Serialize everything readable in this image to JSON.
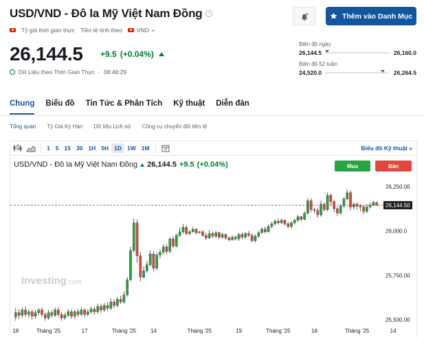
{
  "header": {
    "title": "USD/VND - Đô la Mỹ Việt Nam Đồng",
    "watchlist_label": "Thêm vào Danh Mục",
    "meta_realtime": "Tỷ giá thời gian thực",
    "meta_currency_label": "Tiền tệ tính theo",
    "meta_currency": "VND"
  },
  "quote": {
    "price": "26,144.5",
    "change": "+9.5",
    "change_pct": "(+0.04%)",
    "realtime_note": "Dữ Liệu theo Thời Gian Thực",
    "separator": "·",
    "time": "08:48:29"
  },
  "ranges": {
    "day_label": "Biên độ ngày",
    "day_low": "26,144.5",
    "day_high": "26,160.0",
    "week52_label": "Biên độ 52 tuần",
    "week52_low": "24,520.0",
    "week52_high": "26,264.5"
  },
  "tabs": [
    "Chung",
    "Biểu đồ",
    "Tin Tức & Phân Tích",
    "Kỹ thuật",
    "Diễn đàn"
  ],
  "subnav": [
    "Tổng quan",
    "Tỷ Giá Kỳ Hạn",
    "Dữ liệu Lịch sử",
    "Công cụ chuyển đổi tiền tệ"
  ],
  "toolbar": {
    "intervals": [
      "1",
      "5",
      "15",
      "30",
      "1H",
      "5H",
      "1D",
      "1W",
      "1M"
    ],
    "active_interval": "1D",
    "tech_chart_link": "Biểu đồ Kỹ thuật",
    "tech_chart_arrow": "»"
  },
  "chart_legend": {
    "name": "USD/VND - Đô la Mỹ Việt Nam Đồng",
    "price": "26,144.5",
    "change": "+9.5",
    "change_pct": "(+0.04%)"
  },
  "trade": {
    "buy": "Mua",
    "sell": "Bán"
  },
  "watermark": {
    "brand": "Investing",
    "suffix": ".com"
  },
  "colors": {
    "accent": "#1256a0",
    "up": "#26a541",
    "down": "#e0483b",
    "positive_text": "#007c32"
  },
  "chart_data": {
    "type": "candlestick",
    "y_ticks": [
      25500,
      25750,
      26000,
      26250
    ],
    "y_tick_labels": [
      "25,500.00",
      "25,750.00",
      "26,000.0",
      "26,250.00"
    ],
    "ylim": [
      25485,
      26315
    ],
    "current_price": 26144.5,
    "current_price_label": "26,144.50",
    "x_tick_labels": [
      "18",
      "Tháng '25",
      "17",
      "Tháng '25",
      "14",
      "Tháng '25",
      "19",
      "Tháng '25",
      "16",
      "Tháng '25",
      "14"
    ],
    "x_tick_index": [
      0,
      10,
      21,
      33,
      42,
      56,
      68,
      80,
      91,
      104,
      115
    ],
    "candles": [
      [
        25515,
        25540,
        25495,
        25565
      ],
      [
        25540,
        25525,
        25505,
        25560
      ],
      [
        25525,
        25555,
        25510,
        25570
      ],
      [
        25555,
        25530,
        25515,
        25575
      ],
      [
        25530,
        25545,
        25510,
        25560
      ],
      [
        25545,
        25520,
        25500,
        25555
      ],
      [
        25520,
        25540,
        25505,
        25555
      ],
      [
        25540,
        25555,
        25525,
        25565
      ],
      [
        25555,
        25530,
        25515,
        25570
      ],
      [
        25530,
        25510,
        25495,
        25540
      ],
      [
        25510,
        25540,
        25500,
        25555
      ],
      [
        25540,
        25525,
        25510,
        25555
      ],
      [
        25525,
        25555,
        25515,
        25570
      ],
      [
        25555,
        25530,
        25515,
        25570
      ],
      [
        25530,
        25510,
        25495,
        25545
      ],
      [
        25510,
        25525,
        25500,
        25540
      ],
      [
        25525,
        25545,
        25515,
        25560
      ],
      [
        25545,
        25520,
        25505,
        25560
      ],
      [
        25520,
        25545,
        25505,
        25555
      ],
      [
        25545,
        25530,
        25515,
        25560
      ],
      [
        25530,
        25555,
        25520,
        25570
      ],
      [
        25555,
        25530,
        25515,
        25565
      ],
      [
        25530,
        25545,
        25520,
        25560
      ],
      [
        25545,
        25560,
        25535,
        25575
      ],
      [
        25560,
        25545,
        25530,
        25575
      ],
      [
        25545,
        25575,
        25535,
        25590
      ],
      [
        25575,
        25555,
        25540,
        25590
      ],
      [
        25555,
        25580,
        25545,
        25595
      ],
      [
        25580,
        25565,
        25550,
        25600
      ],
      [
        25565,
        25600,
        25555,
        25620
      ],
      [
        25600,
        25580,
        25565,
        25615
      ],
      [
        25580,
        25615,
        25570,
        25630
      ],
      [
        25615,
        25600,
        25590,
        25635
      ],
      [
        25600,
        25640,
        25590,
        25660
      ],
      [
        25640,
        25725,
        25630,
        25740
      ],
      [
        25725,
        25890,
        25715,
        25910
      ],
      [
        25890,
        26045,
        25880,
        26070
      ],
      [
        26045,
        25860,
        25820,
        26065
      ],
      [
        25860,
        25740,
        25715,
        25880
      ],
      [
        25740,
        25775,
        25730,
        25800
      ],
      [
        25775,
        25810,
        25765,
        25830
      ],
      [
        25810,
        25870,
        25800,
        25890
      ],
      [
        25870,
        25790,
        25775,
        25885
      ],
      [
        25790,
        25865,
        25780,
        25880
      ],
      [
        25865,
        25880,
        25845,
        25895
      ],
      [
        25880,
        25910,
        25870,
        25925
      ],
      [
        25910,
        25885,
        25870,
        25925
      ],
      [
        25885,
        25955,
        25875,
        25965
      ],
      [
        25955,
        25915,
        25905,
        25970
      ],
      [
        25915,
        25975,
        25905,
        25985
      ],
      [
        25975,
        25995,
        25965,
        26020
      ],
      [
        25995,
        26020,
        25985,
        26040
      ],
      [
        26020,
        25985,
        25975,
        26030
      ],
      [
        25985,
        25995,
        25975,
        26005
      ],
      [
        25995,
        26010,
        25990,
        26020
      ],
      [
        26010,
        25990,
        25980,
        26015
      ],
      [
        25990,
        25995,
        25985,
        26000
      ],
      [
        25995,
        25975,
        25965,
        26005
      ],
      [
        25975,
        25960,
        25950,
        25990
      ],
      [
        25960,
        25985,
        25955,
        26005
      ],
      [
        25985,
        25970,
        25960,
        25995
      ],
      [
        25970,
        25990,
        25960,
        26000
      ],
      [
        25990,
        25965,
        25955,
        25995
      ],
      [
        25965,
        25980,
        25955,
        25990
      ],
      [
        25980,
        25960,
        25950,
        25985
      ],
      [
        25960,
        25950,
        25940,
        25970
      ],
      [
        25950,
        25965,
        25945,
        25975
      ],
      [
        25965,
        25955,
        25945,
        25975
      ],
      [
        25955,
        25980,
        25945,
        25990
      ],
      [
        25980,
        25965,
        25955,
        25990
      ],
      [
        25965,
        25985,
        25955,
        25995
      ],
      [
        25985,
        25975,
        25965,
        26000
      ],
      [
        25975,
        25945,
        25935,
        25985
      ],
      [
        25945,
        25970,
        25935,
        25980
      ],
      [
        25970,
        25990,
        25960,
        26000
      ],
      [
        25990,
        26010,
        25985,
        26020
      ],
      [
        26010,
        25995,
        25985,
        26025
      ],
      [
        25995,
        26025,
        25990,
        26035
      ],
      [
        26025,
        26040,
        26015,
        26050
      ],
      [
        26040,
        26055,
        26030,
        26065
      ],
      [
        26055,
        26045,
        26035,
        26070
      ],
      [
        26045,
        26060,
        26040,
        26070
      ],
      [
        26060,
        26040,
        26030,
        26065
      ],
      [
        26040,
        26025,
        26015,
        26050
      ],
      [
        26025,
        26045,
        26015,
        26055
      ],
      [
        26045,
        26060,
        26035,
        26070
      ],
      [
        26060,
        26080,
        26050,
        26090
      ],
      [
        26080,
        26065,
        26055,
        26085
      ],
      [
        26065,
        26100,
        26060,
        26110
      ],
      [
        26100,
        26170,
        26090,
        26185
      ],
      [
        26170,
        26120,
        26105,
        26185
      ],
      [
        26120,
        26115,
        26100,
        26130
      ],
      [
        26115,
        26090,
        26075,
        26130
      ],
      [
        26090,
        26150,
        26080,
        26170
      ],
      [
        26150,
        26120,
        26110,
        26160
      ],
      [
        26120,
        26200,
        26110,
        26215
      ],
      [
        26200,
        26165,
        26145,
        26210
      ],
      [
        26165,
        26125,
        26105,
        26175
      ],
      [
        26125,
        26100,
        26085,
        26135
      ],
      [
        26100,
        26140,
        26090,
        26150
      ],
      [
        26140,
        26180,
        26130,
        26190
      ],
      [
        26180,
        26215,
        26170,
        26235
      ],
      [
        26215,
        26135,
        26115,
        26230
      ],
      [
        26135,
        26150,
        26120,
        26160
      ],
      [
        26150,
        26140,
        26120,
        26160
      ],
      [
        26140,
        26135,
        26110,
        26150
      ],
      [
        26135,
        26110,
        26095,
        26145
      ],
      [
        26110,
        26135,
        26100,
        26150
      ],
      [
        26135,
        26145,
        26125,
        26160
      ],
      [
        26145,
        26160,
        26140,
        26170
      ],
      [
        26160,
        26144.5,
        26140,
        26165
      ]
    ]
  }
}
